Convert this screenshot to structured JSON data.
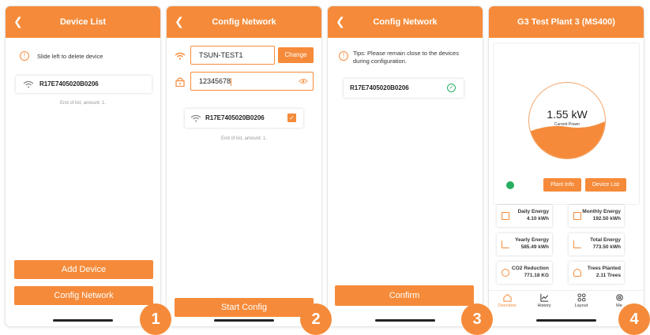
{
  "screen1": {
    "title": "Device List",
    "hint": "Slide left to delete device",
    "device": "R17E7405020B0206",
    "end_text": "End of list, amount: 1.",
    "add_button": "Add Device",
    "config_button": "Config Network"
  },
  "screen2": {
    "title": "Config Network",
    "ssid": "TSUN-TEST1",
    "change_button": "Change",
    "password": "12345678",
    "device": "R17E7405020B0206",
    "end_text": "End of list, amount: 1.",
    "start_button": "Start Config"
  },
  "screen3": {
    "title": "Config Network",
    "tip": "Tips: Please remain close to the devices during configuration.",
    "device": "R17E7405020B0206",
    "confirm_button": "Confirm"
  },
  "screen4": {
    "title": "G3 Test Plant 3 (MS400)",
    "power": "1.55 kW",
    "power_label": "Current Power",
    "plant_info_button": "Plant Info",
    "device_list_button": "Device List",
    "stats": [
      {
        "label": "Daily Energy",
        "value": "4.10 kWh"
      },
      {
        "label": "Monthly Energy",
        "value": "192.50 kWh"
      },
      {
        "label": "Yearly Energy",
        "value": "585.49 kWh"
      },
      {
        "label": "Total Energy",
        "value": "773.50 kWh"
      },
      {
        "label": "CO2 Reduction",
        "value": "771.18 KG"
      },
      {
        "label": "Trees Planted",
        "value": "2.11 Trees"
      }
    ],
    "nav": [
      "Overview",
      "History",
      "Layout",
      "Me"
    ]
  },
  "steps": [
    "1",
    "2",
    "3",
    "4"
  ],
  "colors": {
    "accent": "#f58b3a",
    "success": "#27ae60"
  }
}
